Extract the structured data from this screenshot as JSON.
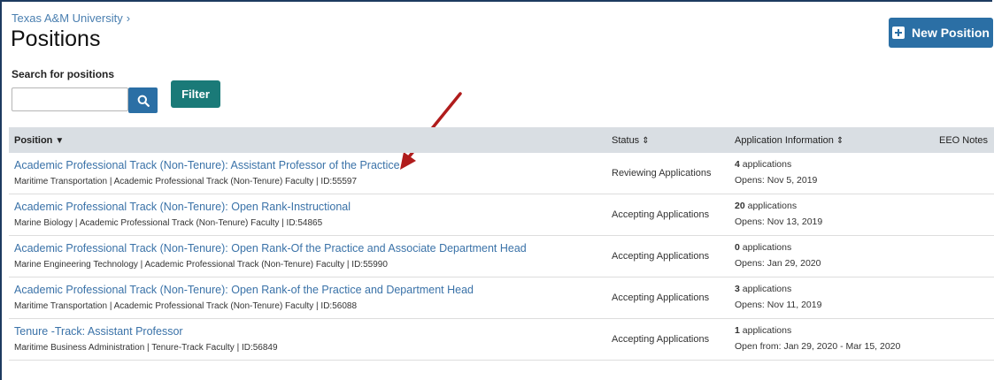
{
  "breadcrumb": {
    "org": "Texas A&M University",
    "separator": "›"
  },
  "page_title": "Positions",
  "new_button_label": "New Position",
  "search": {
    "label": "Search for positions",
    "value": "",
    "filter_label": "Filter"
  },
  "table": {
    "headers": {
      "position": "Position",
      "status": "Status",
      "app_info": "Application Information",
      "eeo": "EEO Notes"
    },
    "rows": [
      {
        "title": "Academic Professional Track (Non-Tenure): Assistant Professor of the Practice",
        "meta": "Maritime Transportation  |  Academic Professional Track (Non-Tenure) Faculty  |  ID:55597",
        "status": "Reviewing Applications",
        "count": "4",
        "count_suffix": "applications",
        "opens": "Opens: Nov 5, 2019"
      },
      {
        "title": "Academic Professional Track (Non-Tenure): Open Rank-Instructional",
        "meta": "Marine Biology  |  Academic Professional Track (Non-Tenure) Faculty  |  ID:54865",
        "status": "Accepting Applications",
        "count": "20",
        "count_suffix": "applications",
        "opens": "Opens: Nov 13, 2019"
      },
      {
        "title": "Academic Professional Track (Non-Tenure): Open Rank-Of the Practice and Associate Department Head",
        "meta": "Marine Engineering Technology  |  Academic Professional Track (Non-Tenure) Faculty  |  ID:55990",
        "status": "Accepting Applications",
        "count": "0",
        "count_suffix": "applications",
        "opens": "Opens: Jan 29, 2020"
      },
      {
        "title": "Academic Professional Track (Non-Tenure): Open Rank-of the Practice and Department Head",
        "meta": "Maritime Transportation  |  Academic Professional Track (Non-Tenure) Faculty  |  ID:56088",
        "status": "Accepting Applications",
        "count": "3",
        "count_suffix": "applications",
        "opens": "Opens: Nov 11, 2019"
      },
      {
        "title": "Tenure -Track: Assistant Professor",
        "meta": "Maritime Business Administration  |  Tenure-Track Faculty  |  ID:56849",
        "status": "Accepting Applications",
        "count": "1",
        "count_suffix": "applications",
        "opens": "Open from: Jan 29, 2020 - Mar 15, 2020"
      }
    ]
  },
  "colors": {
    "link": "#3a72a8",
    "primary_button": "#2b6fa5",
    "filter_button": "#1a7a78",
    "header_bg": "#d9dee3",
    "annotation_arrow": "#b01c1c"
  },
  "icons": [
    "plus-icon",
    "search-icon",
    "sort-caret-down-icon",
    "sort-updown-icon",
    "annotation-arrow"
  ]
}
